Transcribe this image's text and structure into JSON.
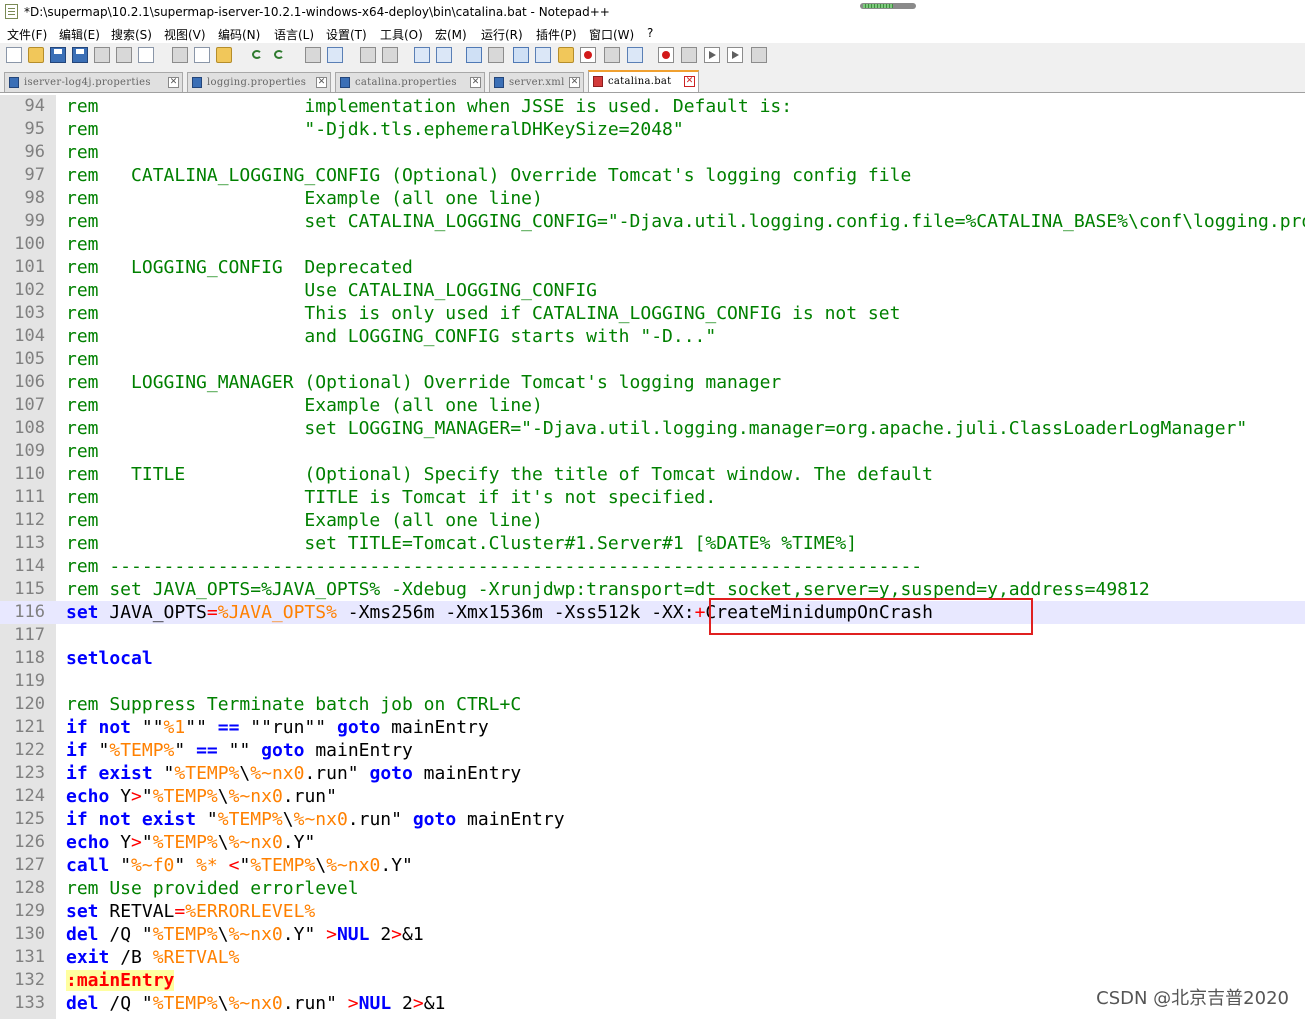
{
  "window": {
    "title": "*D:\\supermap\\10.2.1\\supermap-iserver-10.2.1-windows-x64-deploy\\bin\\catalina.bat - Notepad++"
  },
  "menu": [
    "文件(F)",
    "编辑(E)",
    "搜索(S)",
    "视图(V)",
    "编码(N)",
    "语言(L)",
    "设置(T)",
    "工具(O)",
    "宏(M)",
    "运行(R)",
    "插件(P)",
    "窗口(W)",
    "?"
  ],
  "tabs": [
    {
      "label": "iserver-log4j.properties",
      "active": false
    },
    {
      "label": "logging.properties",
      "active": false
    },
    {
      "label": "catalina.properties",
      "active": false
    },
    {
      "label": "server.xml",
      "active": false
    },
    {
      "label": "catalina.bat",
      "active": true
    }
  ],
  "colors": {
    "comment": "#008000",
    "keyword": "#0000ff",
    "variable": "#ff8000",
    "operator": "#ff0000",
    "current_line": "#e8e8ff",
    "highlight_box": "#e02020"
  },
  "lines": [
    {
      "n": "94",
      "segs": [
        [
          "cm",
          "rem                   implementation when JSSE is used. Default is:"
        ]
      ]
    },
    {
      "n": "95",
      "segs": [
        [
          "cm",
          "rem                   \"-Djdk.tls.ephemeralDHKeySize=2048\""
        ]
      ]
    },
    {
      "n": "96",
      "segs": [
        [
          "cm",
          "rem"
        ]
      ]
    },
    {
      "n": "97",
      "segs": [
        [
          "cm",
          "rem   CATALINA_LOGGING_CONFIG (Optional) Override Tomcat's logging config file"
        ]
      ]
    },
    {
      "n": "98",
      "segs": [
        [
          "cm",
          "rem                   Example (all one line)"
        ]
      ]
    },
    {
      "n": "99",
      "segs": [
        [
          "cm",
          "rem                   set CATALINA_LOGGING_CONFIG=\"-Djava.util.logging.config.file=%CATALINA_BASE%\\conf\\logging.properties\""
        ]
      ]
    },
    {
      "n": "100",
      "segs": [
        [
          "cm",
          "rem"
        ]
      ]
    },
    {
      "n": "101",
      "segs": [
        [
          "cm",
          "rem   LOGGING_CONFIG  Deprecated"
        ]
      ]
    },
    {
      "n": "102",
      "segs": [
        [
          "cm",
          "rem                   Use CATALINA_LOGGING_CONFIG"
        ]
      ]
    },
    {
      "n": "103",
      "segs": [
        [
          "cm",
          "rem                   This is only used if CATALINA_LOGGING_CONFIG is not set"
        ]
      ]
    },
    {
      "n": "104",
      "segs": [
        [
          "cm",
          "rem                   and LOGGING_CONFIG starts with \"-D...\""
        ]
      ]
    },
    {
      "n": "105",
      "segs": [
        [
          "cm",
          "rem"
        ]
      ]
    },
    {
      "n": "106",
      "segs": [
        [
          "cm",
          "rem   LOGGING_MANAGER (Optional) Override Tomcat's logging manager"
        ]
      ]
    },
    {
      "n": "107",
      "segs": [
        [
          "cm",
          "rem                   Example (all one line)"
        ]
      ]
    },
    {
      "n": "108",
      "segs": [
        [
          "cm",
          "rem                   set LOGGING_MANAGER=\"-Djava.util.logging.manager=org.apache.juli.ClassLoaderLogManager\""
        ]
      ]
    },
    {
      "n": "109",
      "segs": [
        [
          "cm",
          "rem"
        ]
      ]
    },
    {
      "n": "110",
      "segs": [
        [
          "cm",
          "rem   TITLE           (Optional) Specify the title of Tomcat window. The default"
        ]
      ]
    },
    {
      "n": "111",
      "segs": [
        [
          "cm",
          "rem                   TITLE is Tomcat if it's not specified."
        ]
      ]
    },
    {
      "n": "112",
      "segs": [
        [
          "cm",
          "rem                   Example (all one line)"
        ]
      ]
    },
    {
      "n": "113",
      "segs": [
        [
          "cm",
          "rem                   set TITLE=Tomcat.Cluster#1.Server#1 [%DATE% %TIME%]"
        ]
      ]
    },
    {
      "n": "114",
      "segs": [
        [
          "cm",
          "rem ---------------------------------------------------------------------------"
        ]
      ]
    },
    {
      "n": "115",
      "segs": [
        [
          "cm",
          "rem set JAVA_OPTS=%JAVA_OPTS% -Xdebug -Xrunjdwp:transport=dt_socket,server=y,suspend=y,address=49812"
        ]
      ]
    },
    {
      "n": "116",
      "current": true,
      "segs": [
        [
          "kw",
          "set"
        ],
        [
          "tx",
          " JAVA_OPTS"
        ],
        [
          "op",
          "="
        ],
        [
          "var",
          "%JAVA_OPTS%"
        ],
        [
          "tx",
          " -Xms256m -Xmx1536m -Xss512k -XX:"
        ],
        [
          "op",
          "+"
        ],
        [
          "tx",
          "CreateMinidumpOnCrash"
        ]
      ]
    },
    {
      "n": "117",
      "segs": []
    },
    {
      "n": "118",
      "segs": [
        [
          "kw",
          "setlocal"
        ]
      ]
    },
    {
      "n": "119",
      "segs": []
    },
    {
      "n": "120",
      "segs": [
        [
          "cm",
          "rem Suppress Terminate batch job on CTRL+C"
        ]
      ]
    },
    {
      "n": "121",
      "segs": [
        [
          "kw",
          "if not"
        ],
        [
          "tx",
          " \"\""
        ],
        [
          "var",
          "%1"
        ],
        [
          "tx",
          "\"\" "
        ],
        [
          "kw",
          "=="
        ],
        [
          "tx",
          " \"\"run\"\" "
        ],
        [
          "kw",
          "goto"
        ],
        [
          "tx",
          " mainEntry"
        ]
      ]
    },
    {
      "n": "122",
      "segs": [
        [
          "kw",
          "if"
        ],
        [
          "tx",
          " \""
        ],
        [
          "var",
          "%TEMP%"
        ],
        [
          "tx",
          "\" "
        ],
        [
          "kw",
          "=="
        ],
        [
          "tx",
          " \"\" "
        ],
        [
          "kw",
          "goto"
        ],
        [
          "tx",
          " mainEntry"
        ]
      ]
    },
    {
      "n": "123",
      "segs": [
        [
          "kw",
          "if exist"
        ],
        [
          "tx",
          " \""
        ],
        [
          "var",
          "%TEMP%"
        ],
        [
          "tx",
          "\\"
        ],
        [
          "var",
          "%~nx0"
        ],
        [
          "tx",
          ".run\" "
        ],
        [
          "kw",
          "goto"
        ],
        [
          "tx",
          " mainEntry"
        ]
      ]
    },
    {
      "n": "124",
      "segs": [
        [
          "kw",
          "echo"
        ],
        [
          "tx",
          " Y"
        ],
        [
          "op",
          ">"
        ],
        [
          "tx",
          "\""
        ],
        [
          "var",
          "%TEMP%"
        ],
        [
          "tx",
          "\\"
        ],
        [
          "var",
          "%~nx0"
        ],
        [
          "tx",
          ".run\""
        ]
      ]
    },
    {
      "n": "125",
      "segs": [
        [
          "kw",
          "if not exist"
        ],
        [
          "tx",
          " \""
        ],
        [
          "var",
          "%TEMP%"
        ],
        [
          "tx",
          "\\"
        ],
        [
          "var",
          "%~nx0"
        ],
        [
          "tx",
          ".run\" "
        ],
        [
          "kw",
          "goto"
        ],
        [
          "tx",
          " mainEntry"
        ]
      ]
    },
    {
      "n": "126",
      "segs": [
        [
          "kw",
          "echo"
        ],
        [
          "tx",
          " Y"
        ],
        [
          "op",
          ">"
        ],
        [
          "tx",
          "\""
        ],
        [
          "var",
          "%TEMP%"
        ],
        [
          "tx",
          "\\"
        ],
        [
          "var",
          "%~nx0"
        ],
        [
          "tx",
          ".Y\""
        ]
      ]
    },
    {
      "n": "127",
      "segs": [
        [
          "kw",
          "call"
        ],
        [
          "tx",
          " \""
        ],
        [
          "var",
          "%~f0"
        ],
        [
          "tx",
          "\" "
        ],
        [
          "var",
          "%*"
        ],
        [
          "tx",
          " "
        ],
        [
          "op",
          "<"
        ],
        [
          "tx",
          "\""
        ],
        [
          "var",
          "%TEMP%"
        ],
        [
          "tx",
          "\\"
        ],
        [
          "var",
          "%~nx0"
        ],
        [
          "tx",
          ".Y\""
        ]
      ]
    },
    {
      "n": "128",
      "segs": [
        [
          "cm",
          "rem Use provided errorlevel"
        ]
      ]
    },
    {
      "n": "129",
      "segs": [
        [
          "kw",
          "set"
        ],
        [
          "tx",
          " RETVAL"
        ],
        [
          "op",
          "="
        ],
        [
          "var",
          "%ERRORLEVEL%"
        ]
      ]
    },
    {
      "n": "130",
      "segs": [
        [
          "kw",
          "del"
        ],
        [
          "tx",
          " /Q \""
        ],
        [
          "var",
          "%TEMP%"
        ],
        [
          "tx",
          "\\"
        ],
        [
          "var",
          "%~nx0"
        ],
        [
          "tx",
          ".Y\" "
        ],
        [
          "op",
          ">"
        ],
        [
          "kw",
          "NUL"
        ],
        [
          "tx",
          " 2"
        ],
        [
          "op",
          ">"
        ],
        [
          "tx",
          "&1"
        ]
      ]
    },
    {
      "n": "131",
      "segs": [
        [
          "kw",
          "exit"
        ],
        [
          "tx",
          " /B "
        ],
        [
          "var",
          "%RETVAL%"
        ]
      ]
    },
    {
      "n": "132",
      "segs": [
        [
          "lbl",
          ":mainEntry"
        ]
      ]
    },
    {
      "n": "133",
      "segs": [
        [
          "kw",
          "del"
        ],
        [
          "tx",
          " /Q \""
        ],
        [
          "var",
          "%TEMP%"
        ],
        [
          "tx",
          "\\"
        ],
        [
          "var",
          "%~nx0"
        ],
        [
          "tx",
          ".run\" "
        ],
        [
          "op",
          ">"
        ],
        [
          "kw",
          "NUL"
        ],
        [
          "tx",
          " 2"
        ],
        [
          "op",
          ">"
        ],
        [
          "tx",
          "&1"
        ]
      ]
    }
  ],
  "watermark": "CSDN @北京吉普2020"
}
